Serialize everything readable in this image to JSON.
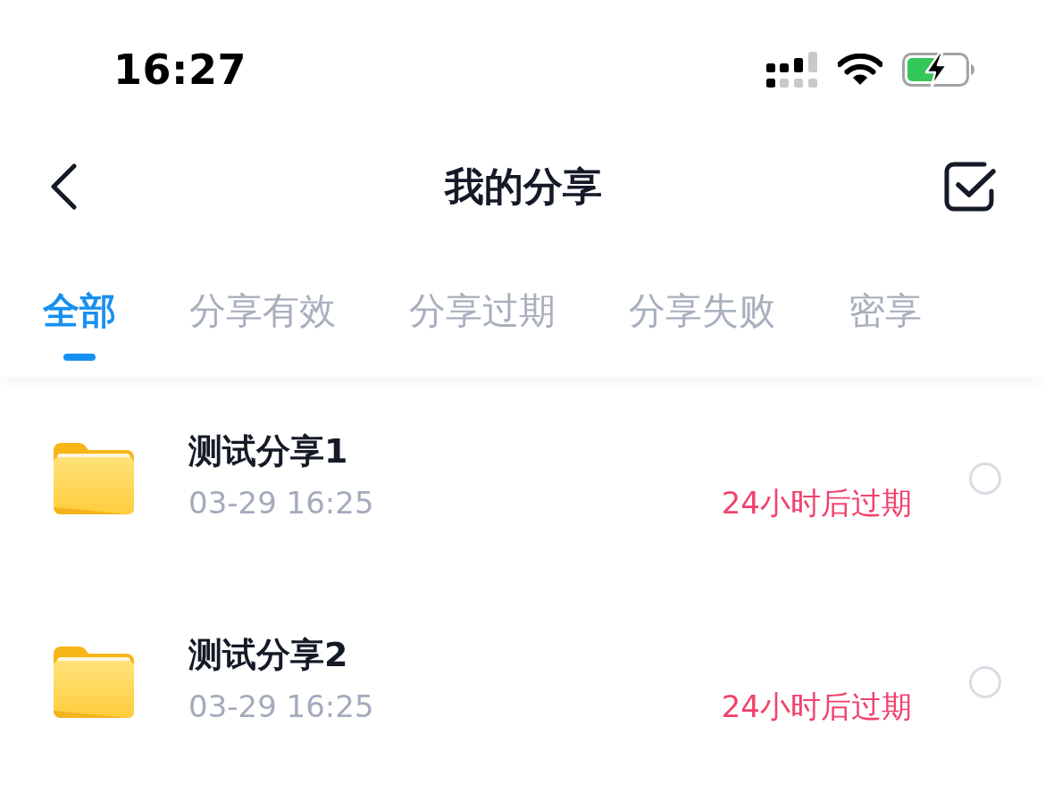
{
  "status_bar": {
    "time": "16:27"
  },
  "header": {
    "title": "我的分享"
  },
  "tabs": [
    {
      "label": "全部",
      "selected": true
    },
    {
      "label": "分享有效",
      "selected": false
    },
    {
      "label": "分享过期",
      "selected": false
    },
    {
      "label": "分享失败",
      "selected": false
    },
    {
      "label": "密享",
      "selected": false
    }
  ],
  "shares": [
    {
      "name": "测试分享1",
      "date": "03-29 16:25",
      "expiry": "24小时后过期",
      "selected": false
    },
    {
      "name": "测试分享2",
      "date": "03-29 16:25",
      "expiry": "24小时后过期",
      "selected": false
    }
  ]
}
